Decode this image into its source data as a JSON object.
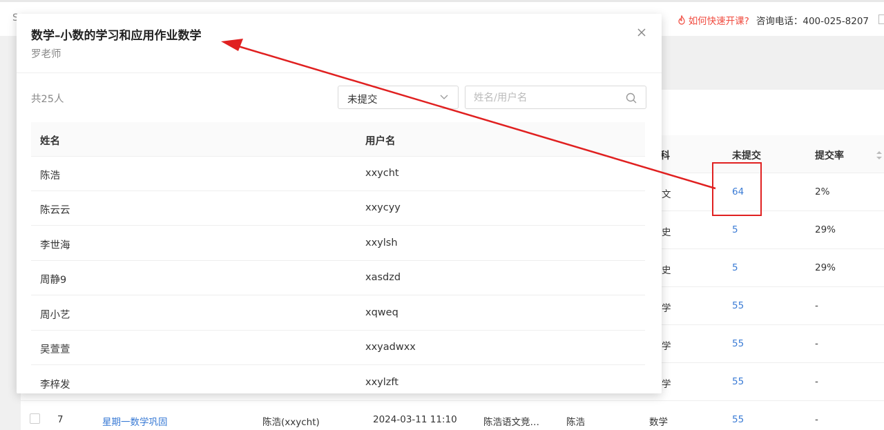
{
  "topbar": {
    "left_stub": "S",
    "quick_link": "如何快速开课?",
    "phone": "咨询电话：400-025-8207",
    "accent_color": "#f04a3e"
  },
  "background_table": {
    "headers": [
      "科",
      "未提交",
      "提交率"
    ],
    "rows": [
      {
        "subject": "文",
        "unsubmitted": "64",
        "rate": "2%"
      },
      {
        "subject": "史",
        "unsubmitted": "5",
        "rate": "29%"
      },
      {
        "subject": "史",
        "unsubmitted": "5",
        "rate": "29%"
      },
      {
        "subject": "学",
        "unsubmitted": "55",
        "rate": "-"
      },
      {
        "subject": "学",
        "unsubmitted": "55",
        "rate": "-"
      },
      {
        "subject": "学",
        "unsubmitted": "55",
        "rate": "-"
      }
    ],
    "last_row": {
      "index": "7",
      "title": "星期一数学巩固",
      "creator": "陈浩(xxycht)",
      "time": "2024-03-11 11:10",
      "class": "陈浩语文竞…",
      "teacher": "陈浩",
      "subject": "数学",
      "unsubmitted": "55",
      "rate": "-"
    },
    "link_color": "#3a7bd5"
  },
  "modal": {
    "title": "数学–小数的学习和应用作业数学",
    "teacher": "罗老师",
    "count": "共25人",
    "filter": {
      "selected": "未提交"
    },
    "search": {
      "placeholder": "姓名/用户名",
      "value": ""
    },
    "columns": [
      "姓名",
      "用户名"
    ],
    "students": [
      {
        "name": "陈浩",
        "username": "xxycht"
      },
      {
        "name": "陈云云",
        "username": "xxycyy"
      },
      {
        "name": "李世海",
        "username": "xxylsh"
      },
      {
        "name": "周静9",
        "username": "xasdzd"
      },
      {
        "name": "周小艺",
        "username": "xqweq"
      },
      {
        "name": "吴萱萱",
        "username": "xxyadwxx"
      },
      {
        "name": "李梓发",
        "username": "xxylzft"
      }
    ]
  },
  "annotation": {
    "color": "#e02020"
  }
}
